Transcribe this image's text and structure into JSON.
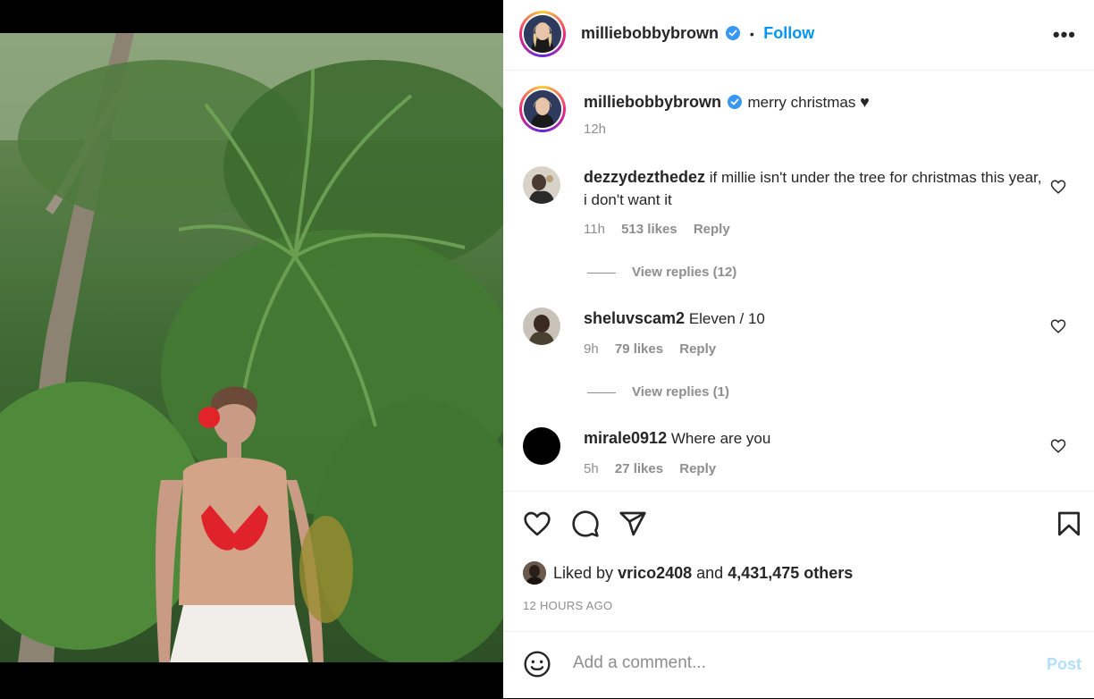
{
  "post": {
    "username": "milliebobbybrown",
    "follow_label": "Follow",
    "dot": "•",
    "more_label": "•••",
    "caption": "merry christmas",
    "caption_heart": "♥",
    "caption_time": "12h"
  },
  "comments": [
    {
      "username": "dezzydezthedez",
      "text": "if millie isn't under the tree for christmas this year, i don't want it",
      "time": "11h",
      "likes": "513 likes",
      "reply_label": "Reply",
      "view_replies": "View replies (12)"
    },
    {
      "username": "sheluvscam2",
      "text": "Eleven / 10",
      "time": "9h",
      "likes": "79 likes",
      "reply_label": "Reply",
      "view_replies": "View replies (1)"
    },
    {
      "username": "mirale0912",
      "text": "Where are you",
      "time": "5h",
      "likes": "27 likes",
      "reply_label": "Reply"
    }
  ],
  "likes": {
    "prefix": "Liked by",
    "user": "vrico2408",
    "and": "and",
    "others": "4,431,475 others"
  },
  "timestamp": "12 HOURS AGO",
  "add_comment": {
    "placeholder": "Add a comment...",
    "post_label": "Post"
  },
  "colors": {
    "link_blue": "#0095f6",
    "post_disabled": "#b2dffc",
    "meta_gray": "#8e8e8e",
    "verified_blue": "#3897f0"
  }
}
